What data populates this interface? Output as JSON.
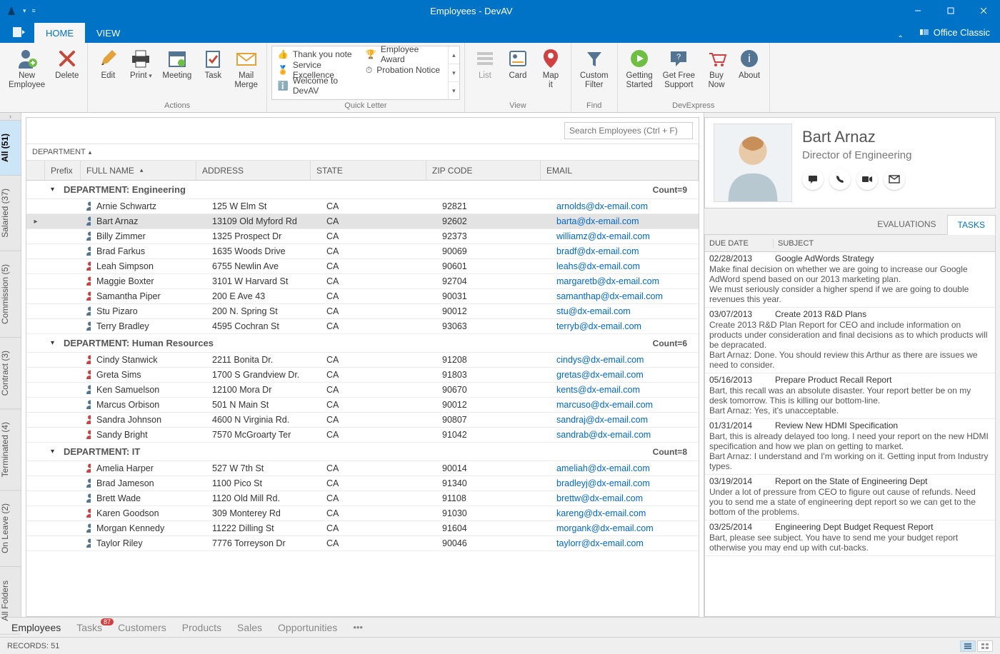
{
  "window": {
    "title": "Employees - DevAV",
    "theme_label": "Office Classic"
  },
  "ribbon": {
    "tabs": [
      "HOME",
      "VIEW"
    ],
    "active_tab": "HOME",
    "groups": {
      "new_delete": {
        "new": "New\nEmployee",
        "delete": "Delete"
      },
      "actions": {
        "label": "Actions",
        "edit": "Edit",
        "print": "Print",
        "meeting": "Meeting",
        "task": "Task",
        "mail_merge": "Mail\nMerge"
      },
      "quick_letter": {
        "label": "Quick Letter",
        "items_col1": [
          "Thank you note",
          "Service Excellence",
          "Welcome to DevAV"
        ],
        "items_col2": [
          "Employee Award",
          "Probation Notice"
        ]
      },
      "view": {
        "label": "View",
        "list": "List",
        "card": "Card",
        "map": "Map\nit"
      },
      "find": {
        "label": "Find",
        "custom_filter": "Custom\nFilter"
      },
      "devexpress": {
        "label": "DevExpress",
        "getting_started": "Getting\nStarted",
        "get_free_support": "Get Free\nSupport",
        "buy_now": "Buy\nNow",
        "about": "About"
      }
    }
  },
  "sidebar": {
    "items": [
      {
        "label": "All (51)",
        "active": true
      },
      {
        "label": "Salaried (37)"
      },
      {
        "label": "Commission (5)"
      },
      {
        "label": "Contract (3)"
      },
      {
        "label": "Terminated (4)"
      },
      {
        "label": "On Leave (2)"
      },
      {
        "label": "All Folders"
      }
    ]
  },
  "grid": {
    "search_placeholder": "Search Employees (Ctrl + F)",
    "group_by": "DEPARTMENT",
    "columns": [
      "Prefix",
      "FULL NAME",
      "ADDRESS",
      "STATE",
      "ZIP CODE",
      "EMAIL"
    ],
    "groups": [
      {
        "title": "DEPARTMENT: Engineering",
        "count": "Count=9",
        "rows": [
          {
            "name": "Arnie Schwartz",
            "addr": "125 W Elm St",
            "state": "CA",
            "zip": "92821",
            "email": "arnolds@dx-email.com",
            "ptype": "m"
          },
          {
            "name": "Bart Arnaz",
            "addr": "13109 Old Myford Rd",
            "state": "CA",
            "zip": "92602",
            "email": "barta@dx-email.com",
            "ptype": "m",
            "selected": true
          },
          {
            "name": "Billy Zimmer",
            "addr": "1325 Prospect Dr",
            "state": "CA",
            "zip": "92373",
            "email": "williamz@dx-email.com",
            "ptype": "m"
          },
          {
            "name": "Brad Farkus",
            "addr": "1635 Woods Drive",
            "state": "CA",
            "zip": "90069",
            "email": "bradf@dx-email.com",
            "ptype": "m"
          },
          {
            "name": "Leah Simpson",
            "addr": "6755 Newlin Ave",
            "state": "CA",
            "zip": "90601",
            "email": "leahs@dx-email.com",
            "ptype": "f"
          },
          {
            "name": "Maggie Boxter",
            "addr": "3101 W Harvard St",
            "state": "CA",
            "zip": "92704",
            "email": "margaretb@dx-email.com",
            "ptype": "f"
          },
          {
            "name": "Samantha Piper",
            "addr": "200 E Ave 43",
            "state": "CA",
            "zip": "90031",
            "email": "samanthap@dx-email.com",
            "ptype": "f"
          },
          {
            "name": "Stu Pizaro",
            "addr": "200 N. Spring St",
            "state": "CA",
            "zip": "90012",
            "email": "stu@dx-email.com",
            "ptype": "m"
          },
          {
            "name": "Terry Bradley",
            "addr": "4595 Cochran St",
            "state": "CA",
            "zip": "93063",
            "email": "terryb@dx-email.com",
            "ptype": "m"
          }
        ]
      },
      {
        "title": "DEPARTMENT: Human Resources",
        "count": "Count=6",
        "rows": [
          {
            "name": "Cindy Stanwick",
            "addr": "2211 Bonita Dr.",
            "state": "CA",
            "zip": "91208",
            "email": "cindys@dx-email.com",
            "ptype": "f"
          },
          {
            "name": "Greta Sims",
            "addr": "1700 S Grandview Dr.",
            "state": "CA",
            "zip": "91803",
            "email": "gretas@dx-email.com",
            "ptype": "f"
          },
          {
            "name": "Ken Samuelson",
            "addr": "12100 Mora Dr",
            "state": "CA",
            "zip": "90670",
            "email": "kents@dx-email.com",
            "ptype": "m"
          },
          {
            "name": "Marcus Orbison",
            "addr": "501 N Main St",
            "state": "CA",
            "zip": "90012",
            "email": "marcuso@dx-email.com",
            "ptype": "m"
          },
          {
            "name": "Sandra Johnson",
            "addr": "4600 N Virginia Rd.",
            "state": "CA",
            "zip": "90807",
            "email": "sandraj@dx-email.com",
            "ptype": "f"
          },
          {
            "name": "Sandy Bright",
            "addr": "7570 McGroarty Ter",
            "state": "CA",
            "zip": "91042",
            "email": "sandrab@dx-email.com",
            "ptype": "f"
          }
        ]
      },
      {
        "title": "DEPARTMENT: IT",
        "count": "Count=8",
        "rows": [
          {
            "name": "Amelia Harper",
            "addr": "527 W 7th St",
            "state": "CA",
            "zip": "90014",
            "email": "ameliah@dx-email.com",
            "ptype": "f"
          },
          {
            "name": "Brad Jameson",
            "addr": "1100 Pico St",
            "state": "CA",
            "zip": "91340",
            "email": "bradleyj@dx-email.com",
            "ptype": "m"
          },
          {
            "name": "Brett Wade",
            "addr": "1120 Old Mill Rd.",
            "state": "CA",
            "zip": "91108",
            "email": "brettw@dx-email.com",
            "ptype": "m"
          },
          {
            "name": "Karen Goodson",
            "addr": "309 Monterey Rd",
            "state": "CA",
            "zip": "91030",
            "email": "kareng@dx-email.com",
            "ptype": "f"
          },
          {
            "name": "Morgan Kennedy",
            "addr": "11222 Dilling St",
            "state": "CA",
            "zip": "91604",
            "email": "morgank@dx-email.com",
            "ptype": "m"
          },
          {
            "name": "Taylor Riley",
            "addr": "7776 Torreyson Dr",
            "state": "CA",
            "zip": "90046",
            "email": "taylorr@dx-email.com",
            "ptype": "m"
          }
        ]
      }
    ]
  },
  "detail": {
    "name": "Bart Arnaz",
    "role": "Director of Engineering",
    "tabs": [
      "EVALUATIONS",
      "TASKS"
    ],
    "active_tab": "TASKS",
    "task_headers": [
      "DUE DATE",
      "SUBJECT"
    ],
    "tasks": [
      {
        "date": "02/28/2013",
        "subj": "Google AdWords Strategy",
        "body": "Make final decision on whether we are going to increase our Google AdWord spend based on our 2013 marketing plan.\nWe must seriously consider a higher spend if we are going to double revenues this year."
      },
      {
        "date": "03/07/2013",
        "subj": "Create 2013 R&D Plans",
        "body": "Create 2013 R&D Plan Report for CEO and include information on products under consideration and final decisions as to which products will be depracated.\nBart Arnaz: Done. You should review this Arthur as there are issues we need to consider."
      },
      {
        "date": "05/16/2013",
        "subj": "Prepare Product Recall Report",
        "body": "Bart, this recall was an absolute disaster. Your report better be on my desk tomorrow. This is killing our bottom-line.\nBart Arnaz: Yes, it's unacceptable."
      },
      {
        "date": "01/31/2014",
        "subj": "Review New HDMI Specification",
        "body": "Bart, this is already delayed too long. I need your report on the new HDMI specification and how we plan on getting to market.\nBart Arnaz: I understand and I'm working on it. Getting input from Industry types."
      },
      {
        "date": "03/19/2014",
        "subj": "Report on the State of Engineering Dept",
        "body": "Under a lot of pressure from CEO to figure out cause of refunds. Need you to send me a state of engineering dept report so we can get to the bottom of the problems."
      },
      {
        "date": "03/25/2014",
        "subj": "Engineering Dept Budget Request Report",
        "body": "Bart, please see subject. You have to send me your budget report otherwise you may end up with cut-backs."
      }
    ]
  },
  "bottom_nav": {
    "items": [
      "Employees",
      "Tasks",
      "Customers",
      "Products",
      "Sales",
      "Opportunities"
    ],
    "active": "Employees",
    "tasks_badge": "87"
  },
  "status": {
    "records": "RECORDS: 51"
  }
}
